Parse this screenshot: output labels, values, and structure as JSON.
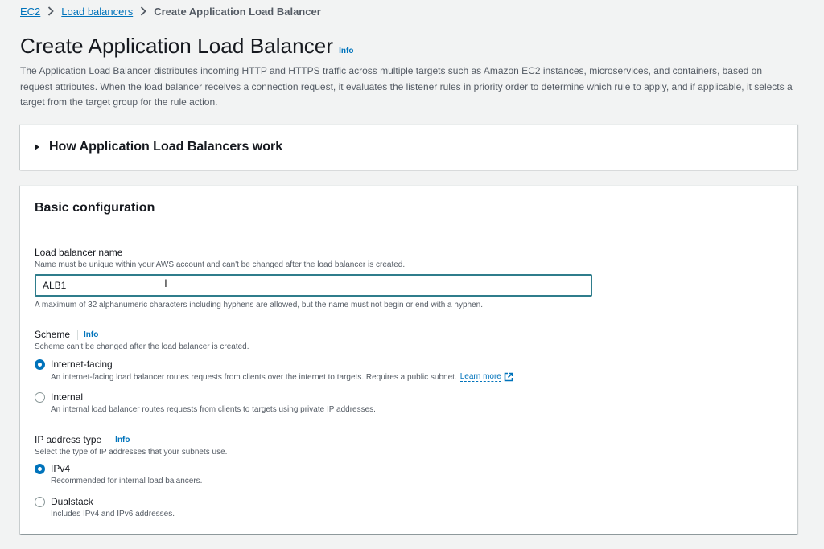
{
  "breadcrumb": {
    "items": [
      "EC2",
      "Load balancers"
    ],
    "current": "Create Application Load Balancer"
  },
  "header": {
    "title": "Create Application Load Balancer",
    "info": "Info",
    "description": "The Application Load Balancer distributes incoming HTTP and HTTPS traffic across multiple targets such as Amazon EC2 instances, microservices, and containers, based on request attributes. When the load balancer receives a connection request, it evaluates the listener rules in priority order to determine which rule to apply, and if applicable, it selects a target from the target group for the rule action."
  },
  "how_it_works": {
    "title": "How Application Load Balancers work"
  },
  "basic_config": {
    "title": "Basic configuration",
    "name_field": {
      "label": "Load balancer name",
      "description": "Name must be unique within your AWS account and can't be changed after the load balancer is created.",
      "value": "ALB1",
      "hint": "A maximum of 32 alphanumeric characters including hyphens are allowed, but the name must not begin or end with a hyphen."
    },
    "scheme": {
      "label": "Scheme",
      "info": "Info",
      "description": "Scheme can't be changed after the load balancer is created.",
      "options": [
        {
          "label": "Internet-facing",
          "description": "An internet-facing load balancer routes requests from clients over the internet to targets. Requires a public subnet.",
          "link": "Learn more",
          "selected": true
        },
        {
          "label": "Internal",
          "description": "An internal load balancer routes requests from clients to targets using private IP addresses.",
          "selected": false
        }
      ]
    },
    "ip_type": {
      "label": "IP address type",
      "info": "Info",
      "description": "Select the type of IP addresses that your subnets use.",
      "options": [
        {
          "label": "IPv4",
          "description": "Recommended for internal load balancers.",
          "selected": true
        },
        {
          "label": "Dualstack",
          "description": "Includes IPv4 and IPv6 addresses.",
          "selected": false
        }
      ]
    }
  },
  "colors": {
    "link": "#0073bb",
    "input_focus": "#2f7d8c",
    "background": "#f2f3f3"
  }
}
